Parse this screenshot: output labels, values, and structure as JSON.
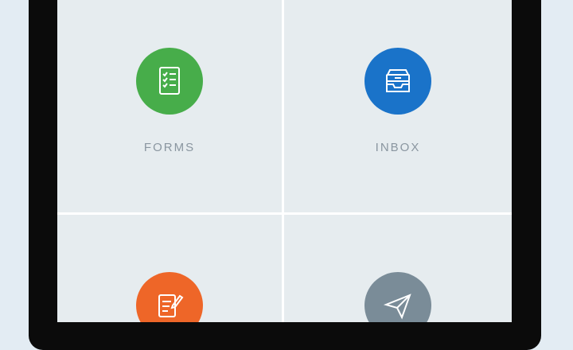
{
  "tiles": [
    {
      "id": "forms",
      "label": "FORMS",
      "icon": "forms-icon",
      "color": "#47ad4a"
    },
    {
      "id": "inbox",
      "label": "INBOX",
      "icon": "inbox-tray-icon",
      "color": "#1a73c9"
    },
    {
      "id": "edit",
      "label": "",
      "icon": "edit-document-icon",
      "color": "#ee6628"
    },
    {
      "id": "send",
      "label": "",
      "icon": "paper-plane-icon",
      "color": "#7a8c98"
    }
  ]
}
